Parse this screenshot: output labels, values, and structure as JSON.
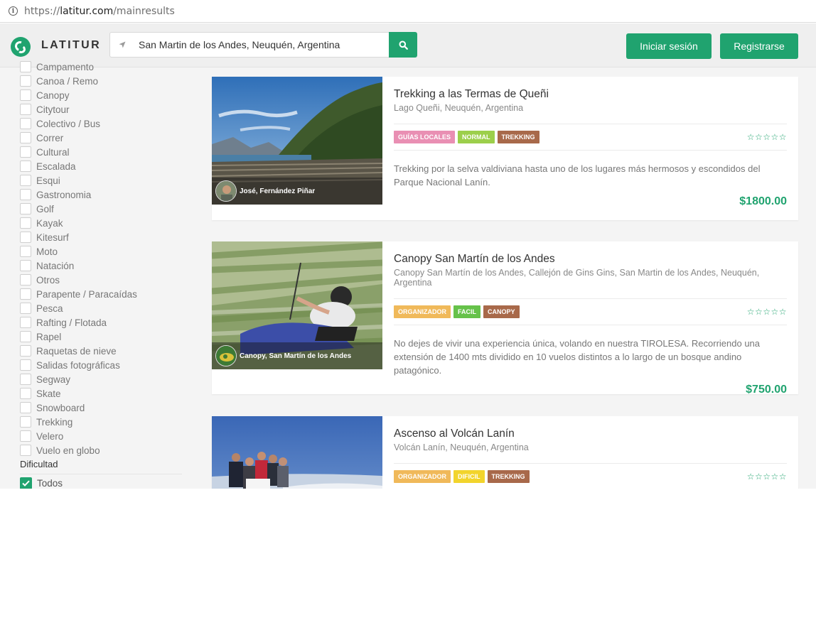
{
  "browser": {
    "url_scheme": "https://",
    "url_host": "latitur.com",
    "url_path": "/mainresults"
  },
  "header": {
    "logo_text": "LATITUR",
    "search_value": "San Martin de los Andes, Neuquén, Argentina",
    "login_label": "Iniciar sesión",
    "register_label": "Registrarse"
  },
  "sidebar": {
    "categories": [
      "Campamento",
      "Canoa / Remo",
      "Canopy",
      "Citytour",
      "Colectivo / Bus",
      "Correr",
      "Cultural",
      "Escalada",
      "Esqui",
      "Gastronomia",
      "Golf",
      "Kayak",
      "Kitesurf",
      "Moto",
      "Natación",
      "Otros",
      "Parapente / Paracaídas",
      "Pesca",
      "Rafting / Flotada",
      "Rapel",
      "Raquetas de nieve",
      "Salidas fotográficas",
      "Segway",
      "Skate",
      "Snowboard",
      "Trekking",
      "Velero",
      "Vuelo en globo"
    ],
    "difficulty_title": "Dificultad",
    "difficulty_option": "Todos"
  },
  "colors": {
    "brand_green": "#20a36f",
    "tag_pink": "#e98fb3",
    "tag_lime": "#9ccf4b",
    "tag_brown": "#a8694a",
    "tag_orange": "#f0b95a",
    "tag_green": "#66c24a",
    "tag_yellow": "#f2d42c"
  },
  "results": [
    {
      "title": "Trekking a las Termas de Queñi",
      "location": "Lago Queñi, Neuquén, Argentina",
      "owner": "José, Fernández Piñar",
      "tags": [
        "GUÍAS LOCALES",
        "NORMAL",
        "TREKKING"
      ],
      "rating_stars": "☆☆☆☆☆",
      "description": "Trekking por la selva valdiviana hasta uno de los lugares más hermosos y escondidos del Parque Nacional Lanín.",
      "price": "$1800.00"
    },
    {
      "title": "Canopy San Martín de los Andes",
      "location": "Canopy San Martín de los Andes, Callejón de Gins Gins, San Martin de los Andes, Neuquén, Argentina",
      "owner": "Canopy, San Martín de los Andes",
      "tags": [
        "ORGANIZADOR",
        "FACIL",
        "CANOPY"
      ],
      "rating_stars": "☆☆☆☆☆",
      "description": "No dejes de vivir una experiencia única, volando en nuestra TIROLESA. Recorriendo una extensión de 1400 mts dividido en 10 vuelos distintos a lo largo de un bosque andino patagónico.",
      "price": "$750.00"
    },
    {
      "title": "Ascenso al Volcán Lanín",
      "location": "Volcán Lanín, Neuquén, Argentina",
      "tags": [
        "ORGANIZADOR",
        "DIFICIL",
        "TREKKING"
      ],
      "rating_stars": "☆☆☆☆☆"
    }
  ]
}
